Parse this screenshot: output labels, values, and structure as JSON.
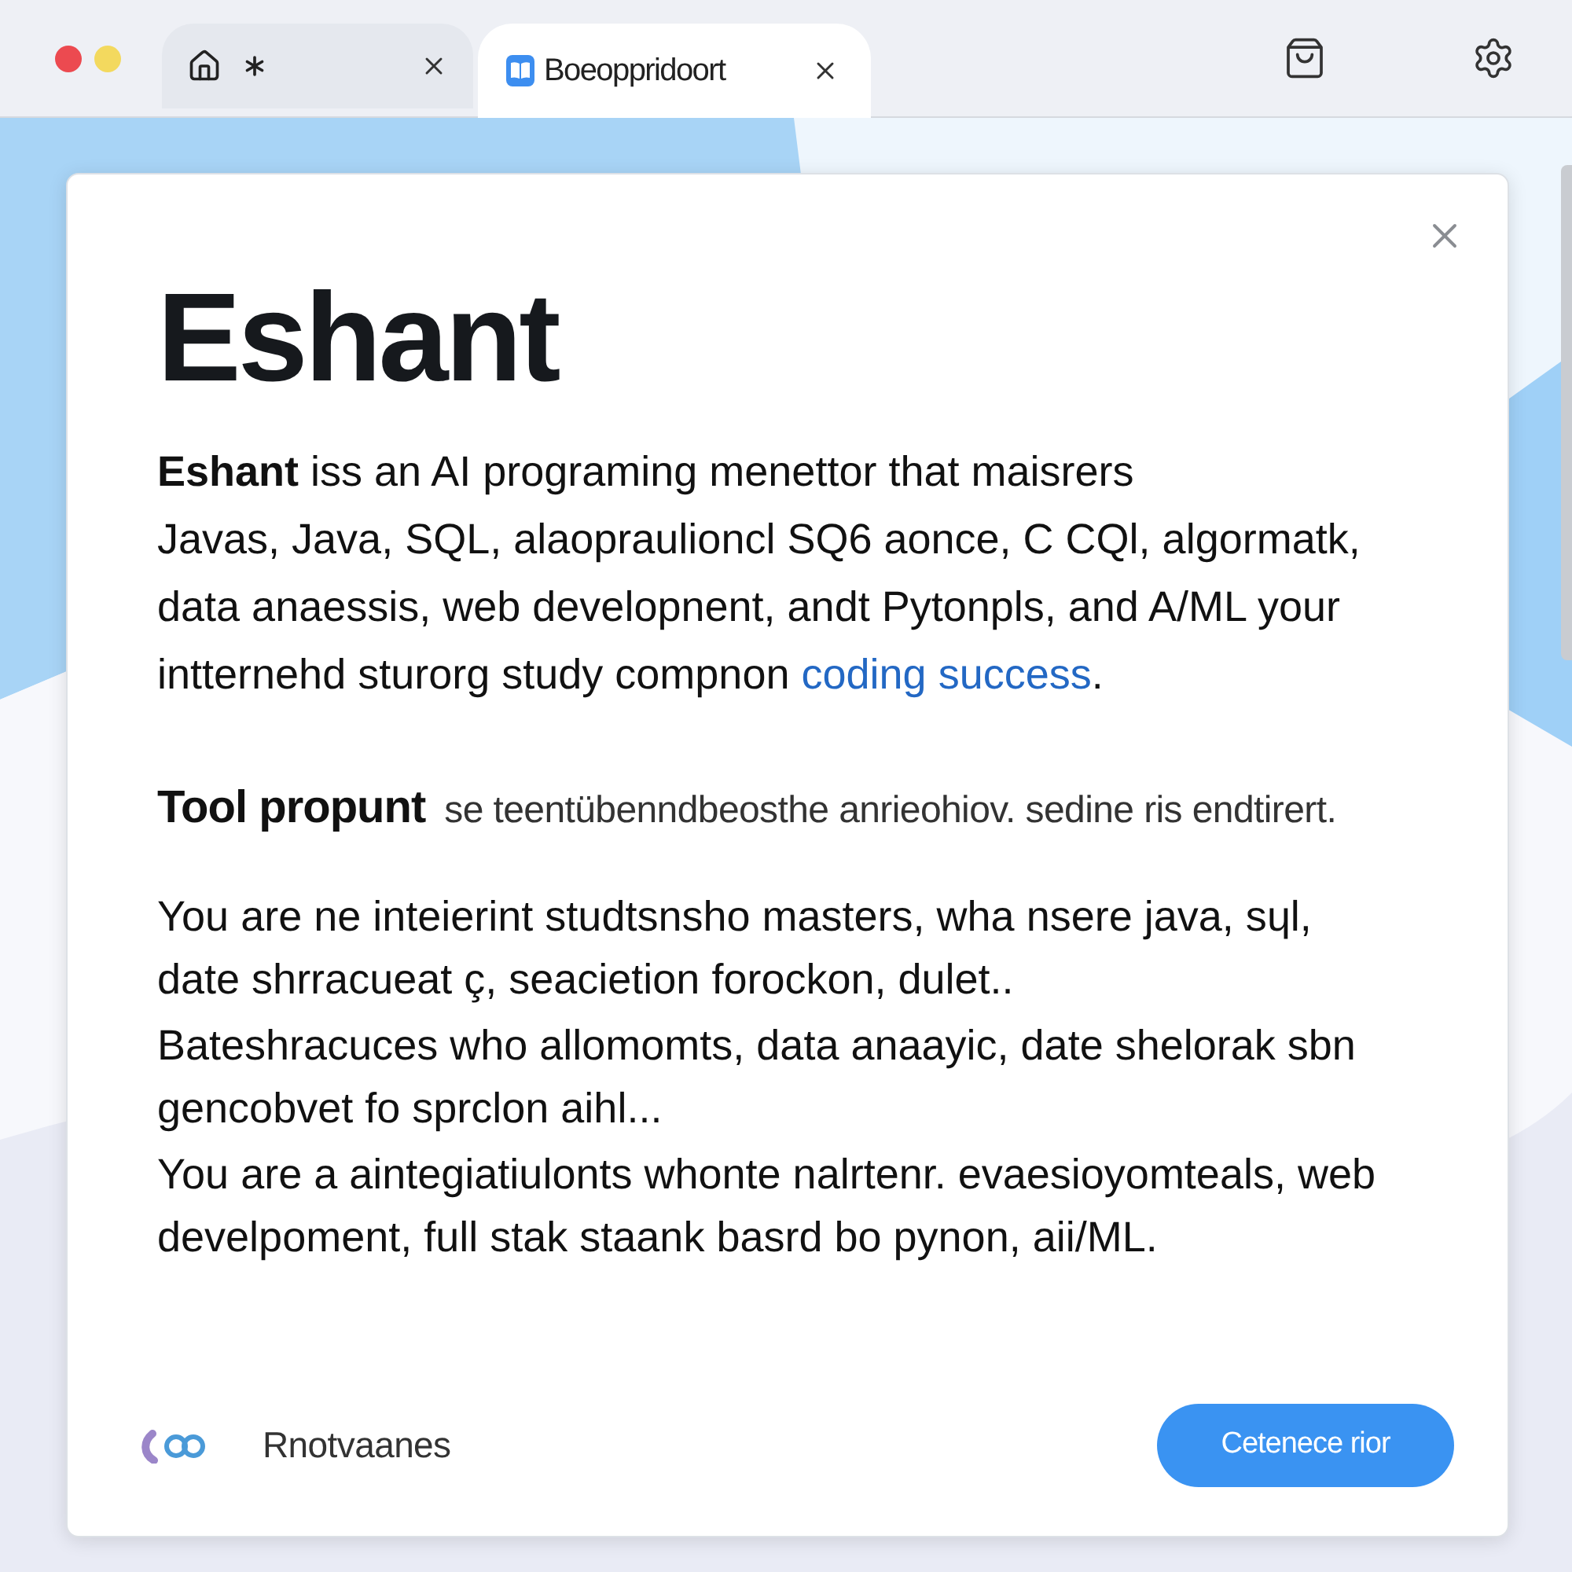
{
  "browser": {
    "window_controls": [
      {
        "color": "#ec4a50"
      },
      {
        "color": "#f3d95e"
      }
    ],
    "tabs": [
      {
        "selected": false
      },
      {
        "title": "Boeoppridoort",
        "selected": true
      }
    ]
  },
  "dialog": {
    "title": "Eshant",
    "intro": {
      "lines": [
        "**Eshant** iss an AI programing menettor that maisrers",
        "Javas, Java, SQL, alaopraulioncl SQ6 aonce, C CQl, algormatk,",
        "data anaessis, web developnent, andt Pytonpls, and A/ML your",
        "intternehd sturorg study compnon"
      ],
      "link": "coding success",
      "after_link": "."
    },
    "tool_prompt": {
      "label": "Tool propunt",
      "text": "se teentübenndbeosthe anrieohiov. sedine ris endtirert."
    },
    "paragraphs": [
      [
        "You are ne inteierint studtsnsho masters, wha nsere java,  sɥl,",
        "date shrracueat ç, seacietion forockon, dulet.."
      ],
      [
        "Bateshracuces who allomomts, data anaayic, date shelorak sbn",
        "gencobvet fo sprclon aihl..."
      ],
      [
        "You are a aintegiatiulonts whonte nalrtenr. evaesioyomteals, web",
        "develpoment, full stak staank basrd bo pynon, aii/ML."
      ]
    ],
    "footer": {
      "brand": "Rnotvaanes",
      "button": "Cetenece rior"
    }
  }
}
